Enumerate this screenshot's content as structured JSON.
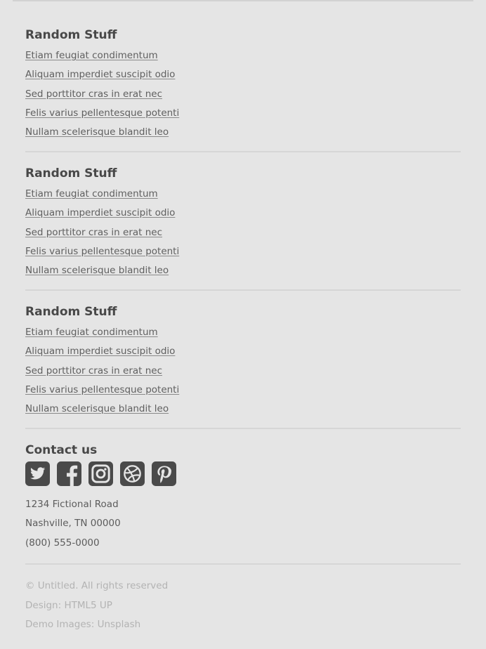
{
  "sections": [
    {
      "heading": "Random Stuff",
      "links": [
        "Etiam feugiat condimentum",
        "Aliquam imperdiet suscipit odio",
        "Sed porttitor cras in erat nec",
        "Felis varius pellentesque potenti",
        "Nullam scelerisque blandit leo"
      ]
    },
    {
      "heading": "Random Stuff",
      "links": [
        "Etiam feugiat condimentum",
        "Aliquam imperdiet suscipit odio",
        "Sed porttitor cras in erat nec",
        "Felis varius pellentesque potenti",
        "Nullam scelerisque blandit leo"
      ]
    },
    {
      "heading": "Random Stuff",
      "links": [
        "Etiam feugiat condimentum",
        "Aliquam imperdiet suscipit odio",
        "Sed porttitor cras in erat nec",
        "Felis varius pellentesque potenti",
        "Nullam scelerisque blandit leo"
      ]
    }
  ],
  "contact": {
    "heading": "Contact us",
    "social_icons": [
      "twitter-icon",
      "facebook-icon",
      "instagram-icon",
      "dribbble-icon",
      "pinterest-icon"
    ],
    "address": {
      "street": "1234 Fictional Road",
      "city": "Nashville, TN 00000",
      "phone": "(800) 555-0000"
    }
  },
  "copyright": {
    "notice": "© Untitled. All rights reserved",
    "design_prefix": "Design: ",
    "design_link": "HTML5 UP",
    "images_prefix": "Demo Images: ",
    "images_link": "Unsplash"
  },
  "colors": {
    "background": "#e5e5e5",
    "heading": "#484848",
    "link": "#606060",
    "icon": "#4a4a4a",
    "muted": "#b3b3b3",
    "divider": "#d6d6d6"
  }
}
